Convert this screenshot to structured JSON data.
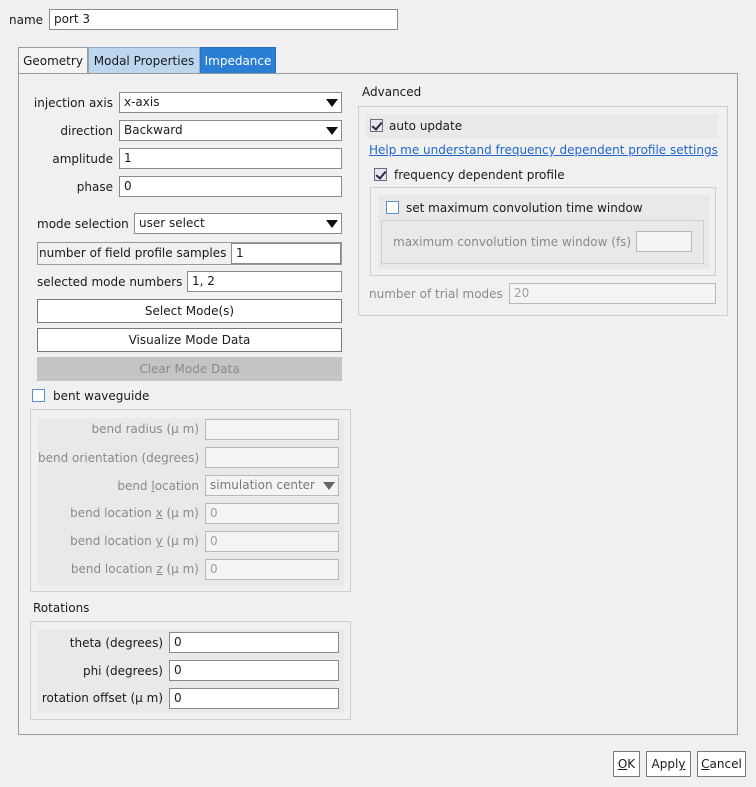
{
  "header": {
    "name_label": "name",
    "name_value": "port 3"
  },
  "tabs": [
    {
      "label": "Geometry"
    },
    {
      "label": "Modal Properties"
    },
    {
      "label": "Impedance"
    }
  ],
  "left": {
    "injection_axis": {
      "label": "injection axis",
      "value": "x-axis"
    },
    "direction": {
      "label": "direction",
      "value": "Backward"
    },
    "amplitude": {
      "label": "amplitude",
      "value": "1"
    },
    "phase": {
      "label": "phase",
      "value": "0"
    },
    "mode_selection": {
      "label": "mode selection",
      "value": "user select"
    },
    "field_profile_samples": {
      "label": "number of field profile samples",
      "value": "1"
    },
    "selected_modes": {
      "label": "selected mode numbers",
      "value": "1, 2"
    },
    "select_modes_button": "Select Mode(s)",
    "visualize_button": "Visualize Mode Data",
    "clear_button": "Clear Mode Data",
    "bent_waveguide": {
      "label": "bent waveguide",
      "checked": false
    },
    "bend": {
      "radius_label": "bend radius (µ m)",
      "orientation_label": "bend orientation (degrees)",
      "location_label_pre": "bend ",
      "location_label_ul": "l",
      "location_label_post": "ocation",
      "location_value": "simulation center",
      "loc_x_pre": "bend location ",
      "loc_x_ul": "x",
      "loc_x_post": " (µ m)",
      "loc_x_value": "0",
      "loc_y_pre": "bend location ",
      "loc_y_ul": "y",
      "loc_y_post": " (µ m)",
      "loc_y_value": "0",
      "loc_z_pre": "bend location ",
      "loc_z_ul": "z",
      "loc_z_post": " (µ m)",
      "loc_z_value": "0"
    },
    "rotations": {
      "title": "Rotations",
      "theta_label": "theta (degrees)",
      "theta_value": "0",
      "phi_label": "phi (degrees)",
      "phi_value": "0",
      "offset_label": "rotation offset (µ m)",
      "offset_value": "0"
    }
  },
  "advanced": {
    "title": "Advanced",
    "auto_update": {
      "label": "auto update",
      "checked": true
    },
    "help_link": "Help me understand frequency dependent profile settings",
    "freq_dep": {
      "label": "frequency dependent profile",
      "checked": true
    },
    "set_max_conv": {
      "label": "set maximum convolution time window",
      "checked": false
    },
    "max_conv_label": "maximum convolution time window (fs)",
    "max_conv_value": "",
    "trial_modes_label": "number of trial modes",
    "trial_modes_value": "20"
  },
  "footer": {
    "ok_ul": "O",
    "ok_rest": "K",
    "apply_pre": "Appl",
    "apply_ul": "y",
    "cancel_ul": "C",
    "cancel_rest": "ancel"
  },
  "colors": {
    "tab_active": "#bcd6ee",
    "tab_impedance": "#2a7fd4",
    "link": "#2266cc"
  }
}
